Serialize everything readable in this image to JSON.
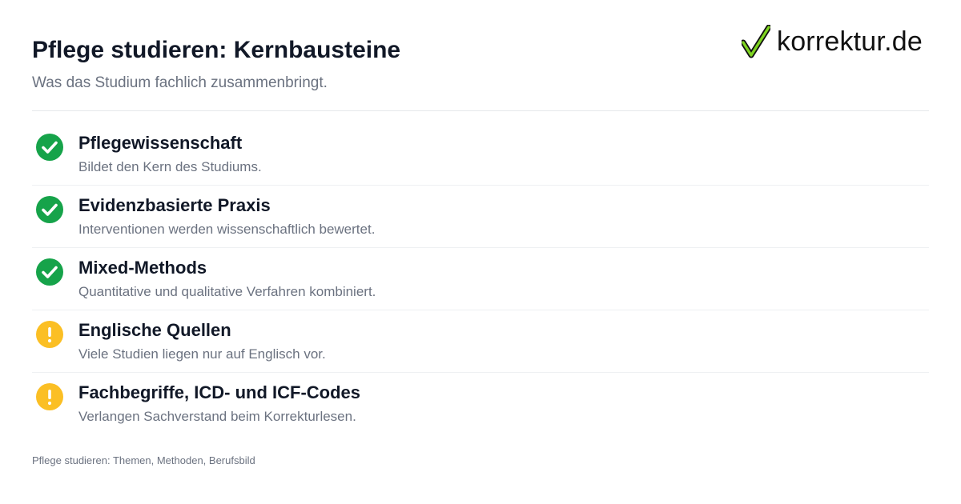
{
  "header": {
    "title": "Pflege studieren: Kernbausteine",
    "subtitle": "Was das Studium fachlich zusammenbringt."
  },
  "logo": {
    "text": "korrektur.de",
    "icon": "checkmark-logo-icon",
    "accent_color": "#7ed321"
  },
  "items": [
    {
      "title": "Pflegewissenschaft",
      "description": "Bildet den Kern des Studiums.",
      "status": "check",
      "icon": "check-circle-icon",
      "color": "#16a34a"
    },
    {
      "title": "Evidenzbasierte Praxis",
      "description": "Interventionen werden wissenschaftlich bewertet.",
      "status": "check",
      "icon": "check-circle-icon",
      "color": "#16a34a"
    },
    {
      "title": "Mixed-Methods",
      "description": "Quantitative und qualitative Verfahren kombiniert.",
      "status": "check",
      "icon": "check-circle-icon",
      "color": "#16a34a"
    },
    {
      "title": "Englische Quellen",
      "description": "Viele Studien liegen nur auf Englisch vor.",
      "status": "warning",
      "icon": "warning-circle-icon",
      "color": "#fbbf24"
    },
    {
      "title": "Fachbegriffe, ICD- und ICF-Codes",
      "description": "Verlangen Sachverstand beim Korrekturlesen.",
      "status": "warning",
      "icon": "warning-circle-icon",
      "color": "#fbbf24"
    }
  ],
  "footer": {
    "text": "Pflege studieren: Themen, Methoden, Berufsbild"
  }
}
